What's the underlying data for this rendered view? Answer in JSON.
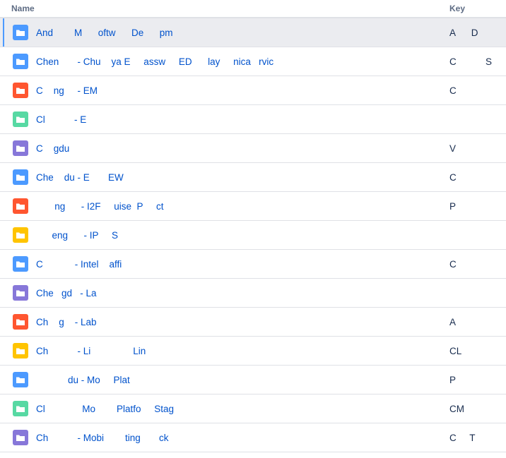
{
  "header": {
    "name_label": "Name",
    "key_label": "Key"
  },
  "rows": [
    {
      "name": "And        M      oftw      De      pm",
      "key": "A      D",
      "color": "#4c9aff",
      "icon": "folder-icon",
      "selected": true
    },
    {
      "name": "Chen       - Chu    ya E     assw     ED      lay     nica   rvic",
      "key": "C           S",
      "color": "#4c9aff",
      "icon": "folder-icon",
      "selected": false
    },
    {
      "name": "C    ng     - EM",
      "key": "C",
      "color": "#ff5630",
      "icon": "folder-icon",
      "selected": false
    },
    {
      "name": "Cl           - E",
      "key": "",
      "color": "#57d9a3",
      "icon": "folder-icon",
      "selected": false
    },
    {
      "name": "C    gdu",
      "key": "V",
      "color": "#8777d9",
      "icon": "folder-icon",
      "selected": false
    },
    {
      "name": "Che    du - E       EW",
      "key": "C",
      "color": "#4c9aff",
      "icon": "folder-icon",
      "selected": false
    },
    {
      "name": "       ng      - I2F     uise  P     ct",
      "key": "P",
      "color": "#ff5630",
      "icon": "folder-icon",
      "selected": false
    },
    {
      "name": "      eng      - IP     S",
      "key": "",
      "color": "#ffc400",
      "icon": "folder-icon",
      "selected": false
    },
    {
      "name": "C            - Intel    affi",
      "key": "C",
      "color": "#4c9aff",
      "icon": "folder-icon",
      "selected": false
    },
    {
      "name": "Che   gd   - La",
      "key": "",
      "color": "#8777d9",
      "icon": "folder-icon",
      "selected": false
    },
    {
      "name": "Ch    g    - Lab",
      "key": "A",
      "color": "#ff5630",
      "icon": "folder-icon",
      "selected": false
    },
    {
      "name": "Ch           - Li                Lin",
      "key": "CL",
      "color": "#ffc400",
      "icon": "folder-icon",
      "selected": false
    },
    {
      "name": "            du - Mo     Plat",
      "key": "P",
      "color": "#4c9aff",
      "icon": "folder-icon",
      "selected": false
    },
    {
      "name": "Cl              Mo        Platfo     Stag",
      "key": "CM",
      "color": "#57d9a3",
      "icon": "folder-icon",
      "selected": false
    },
    {
      "name": "Ch           - Mobi        ting       ck",
      "key": "C     T",
      "color": "#8777d9",
      "icon": "folder-icon",
      "selected": false
    }
  ]
}
